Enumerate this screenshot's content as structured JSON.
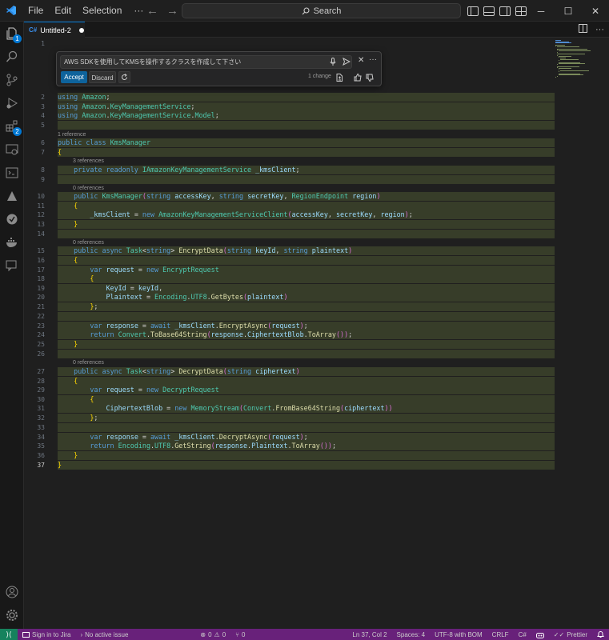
{
  "menu": {
    "file": "File",
    "edit": "Edit",
    "selection": "Selection",
    "more": "···"
  },
  "search": {
    "label": "Search"
  },
  "tab": {
    "lang": "C#",
    "title": "Untitled-2"
  },
  "chat": {
    "prompt": "AWS SDKを使用してKMSを操作するクラスを作成して下さい",
    "accept": "Accept",
    "discard": "Discard",
    "changes": "1 change"
  },
  "badges": {
    "explorer": "1",
    "extensions": "2"
  },
  "lenses": {
    "l6": "1 reference",
    "l8": "3 references",
    "l10": "0 references",
    "l15": "0 references",
    "l27": "0 references"
  },
  "code_lines": [
    {
      "n": "1",
      "text": ""
    },
    {
      "n": "2",
      "text": "using Amazon;"
    },
    {
      "n": "3",
      "text": "using Amazon.KeyManagementService;"
    },
    {
      "n": "4",
      "text": "using Amazon.KeyManagementService.Model;"
    },
    {
      "n": "5",
      "text": ""
    },
    {
      "n": "6",
      "text": "public class KmsManager"
    },
    {
      "n": "7",
      "text": "{"
    },
    {
      "n": "8",
      "text": "    private readonly IAmazonKeyManagementService _kmsClient;"
    },
    {
      "n": "9",
      "text": ""
    },
    {
      "n": "10",
      "text": "    public KmsManager(string accessKey, string secretKey, RegionEndpoint region)"
    },
    {
      "n": "11",
      "text": "    {"
    },
    {
      "n": "12",
      "text": "        _kmsClient = new AmazonKeyManagementServiceClient(accessKey, secretKey, region);"
    },
    {
      "n": "13",
      "text": "    }"
    },
    {
      "n": "14",
      "text": ""
    },
    {
      "n": "15",
      "text": "    public async Task<string> EncryptData(string keyId, string plaintext)"
    },
    {
      "n": "16",
      "text": "    {"
    },
    {
      "n": "17",
      "text": "        var request = new EncryptRequest"
    },
    {
      "n": "18",
      "text": "        {"
    },
    {
      "n": "19",
      "text": "            KeyId = keyId,"
    },
    {
      "n": "20",
      "text": "            Plaintext = Encoding.UTF8.GetBytes(plaintext)"
    },
    {
      "n": "21",
      "text": "        };"
    },
    {
      "n": "22",
      "text": ""
    },
    {
      "n": "23",
      "text": "        var response = await _kmsClient.EncryptAsync(request);"
    },
    {
      "n": "24",
      "text": "        return Convert.ToBase64String(response.CiphertextBlob.ToArray());"
    },
    {
      "n": "25",
      "text": "    }"
    },
    {
      "n": "26",
      "text": ""
    },
    {
      "n": "27",
      "text": "    public async Task<string> DecryptData(string ciphertext)"
    },
    {
      "n": "28",
      "text": "    {"
    },
    {
      "n": "29",
      "text": "        var request = new DecryptRequest"
    },
    {
      "n": "30",
      "text": "        {"
    },
    {
      "n": "31",
      "text": "            CiphertextBlob = new MemoryStream(Convert.FromBase64String(ciphertext))"
    },
    {
      "n": "32",
      "text": "        };"
    },
    {
      "n": "33",
      "text": ""
    },
    {
      "n": "34",
      "text": "        var response = await _kmsClient.DecryptAsync(request);"
    },
    {
      "n": "35",
      "text": "        return Encoding.UTF8.GetString(response.Plaintext.ToArray());"
    },
    {
      "n": "36",
      "text": "    }"
    },
    {
      "n": "37",
      "text": "}"
    }
  ],
  "status": {
    "jira": "Sign in to Jira",
    "issue": "No active issue",
    "errors": "0",
    "warnings": "0",
    "ports": "0",
    "position": "Ln 37, Col 2",
    "spaces": "Spaces: 4",
    "encoding": "UTF-8 with BOM",
    "eol": "CRLF",
    "language": "C#",
    "prettier": "Prettier"
  },
  "colors": {
    "accent": "#0078d4",
    "diff_highlight": "#373d29",
    "statusbar": "#68217a",
    "keyword": "#569cd6",
    "type": "#4ec9b0",
    "function": "#dcdcaa",
    "parameter": "#9cdcfe"
  }
}
